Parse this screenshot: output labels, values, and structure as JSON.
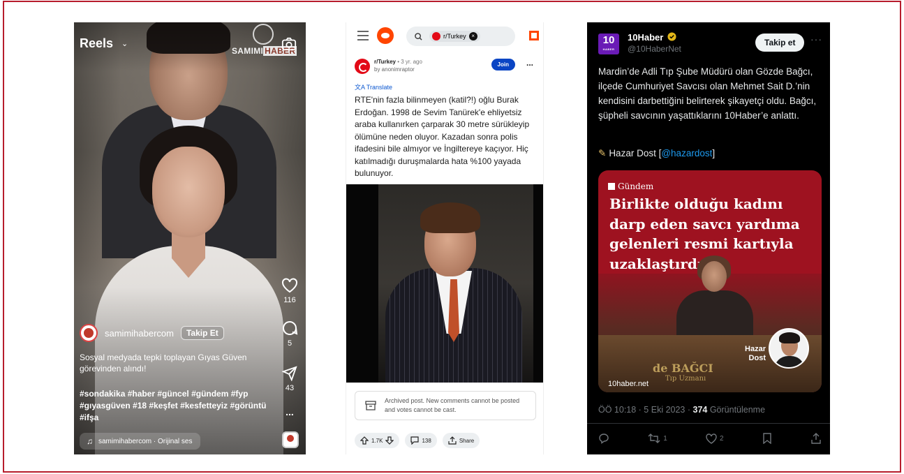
{
  "reels": {
    "title": "Reels",
    "brand_left": "SAMIMI",
    "brand_right": "HABER",
    "likes": "116",
    "comments": "5",
    "shares": "43",
    "more": "...",
    "username": "samimihabercom",
    "follow_label": "Takip Et",
    "caption": "Sosyal medyada tepki toplayan Gıyas Güven görevinden alındı!",
    "hashtags": "#sondakika #haber #güncel #gündem #fyp #gıyasgüven #18 #keşfet #kesfetteyiz #görüntü #ifşa",
    "audio": "samimihabercom · Orijinal ses"
  },
  "reddit": {
    "search_chip": "r/Turkey",
    "subreddit": "r/Turkey",
    "age": " • 3 yr. ago",
    "author": "by anonimraptor",
    "join_label": "Join",
    "more": "...",
    "translate": "Translate",
    "post_text": "RTE'nin fazla bilinmeyen (katil?!) oğlu Burak Erdoğan. 1998 de Sevim Tanürek'e ehliyetsiz araba kullanırken çarparak 30 metre sürükleyip ölümüne neden oluyor. Kazadan sonra polis ifadesini bile almıyor ve İngiltereye kaçıyor. Hiç katılmadığı duruşmalarda hata %100 yayada bulunuyor.",
    "archived_notice": "Archived post. New comments cannot be posted and votes cannot be cast.",
    "votes": "1.7K",
    "comments": "138",
    "share_label": "Share"
  },
  "tweet": {
    "avatar_big": "10",
    "avatar_small": "HABER",
    "name": "10Haber",
    "handle": "@10HaberNet",
    "follow_label": "Takip et",
    "more": "···",
    "text": "Mardin’de Adli Tıp Şube Müdürü olan Gözde Bağcı, ilçede Cumhuriyet Savcısı olan Mehmet Sait D.’nin kendisini darbettiğini belirterek şikayetçi oldu. Bağcı, şüpheli savcının yaşattıklarını 10Haber’e anlattı.",
    "credit_prefix": "Hazar Dost [",
    "credit_mention": "@hazardost",
    "credit_suffix": "]",
    "card_label": "Gündem",
    "card_headline": "Birlikte olduğu kadını darp eden savcı yardıma gelenleri resmi kartıyla uzaklaştırdı",
    "card_reporter": "Hazar Dost",
    "card_nameplate": "de BAĞCI",
    "card_nameplate2": "Tıp Uzmanı",
    "card_source": "10haber.net",
    "meta_time": "ÖÖ 10:18 · 5 Eki 2023 · ",
    "meta_views": "374",
    "meta_views_label": " Görüntülenme",
    "retweets": "1",
    "likes": "2"
  }
}
